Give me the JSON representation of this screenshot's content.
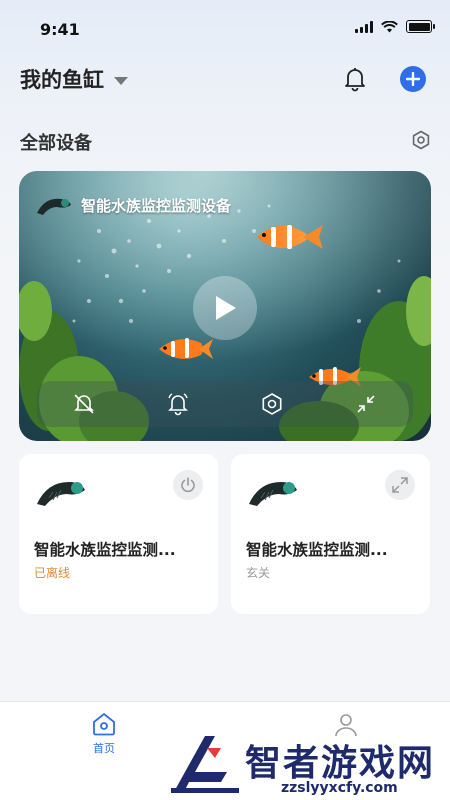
{
  "status_bar": {
    "time": "9:41"
  },
  "header": {
    "home_name": "我的鱼缸"
  },
  "section": {
    "title": "全部设备"
  },
  "video": {
    "title": "智能水族监控监测设备"
  },
  "devices": [
    {
      "name": "智能水族监控监测...",
      "status": "已离线",
      "status_color": "#e08a3c",
      "action_icon": "power-icon"
    },
    {
      "name": "智能水族监控监测...",
      "status": "玄关",
      "status_color": "#999999",
      "action_icon": "expand-icon"
    }
  ],
  "tabs": [
    {
      "label": "首页",
      "icon": "home-icon",
      "active": true
    },
    {
      "label": "",
      "icon": "profile-icon",
      "active": false
    }
  ],
  "watermark": {
    "text": "智者游戏网",
    "url": "zzslyyxcfy.com"
  },
  "colors": {
    "accent": "#2f6ee8",
    "offline": "#e08a3c"
  }
}
